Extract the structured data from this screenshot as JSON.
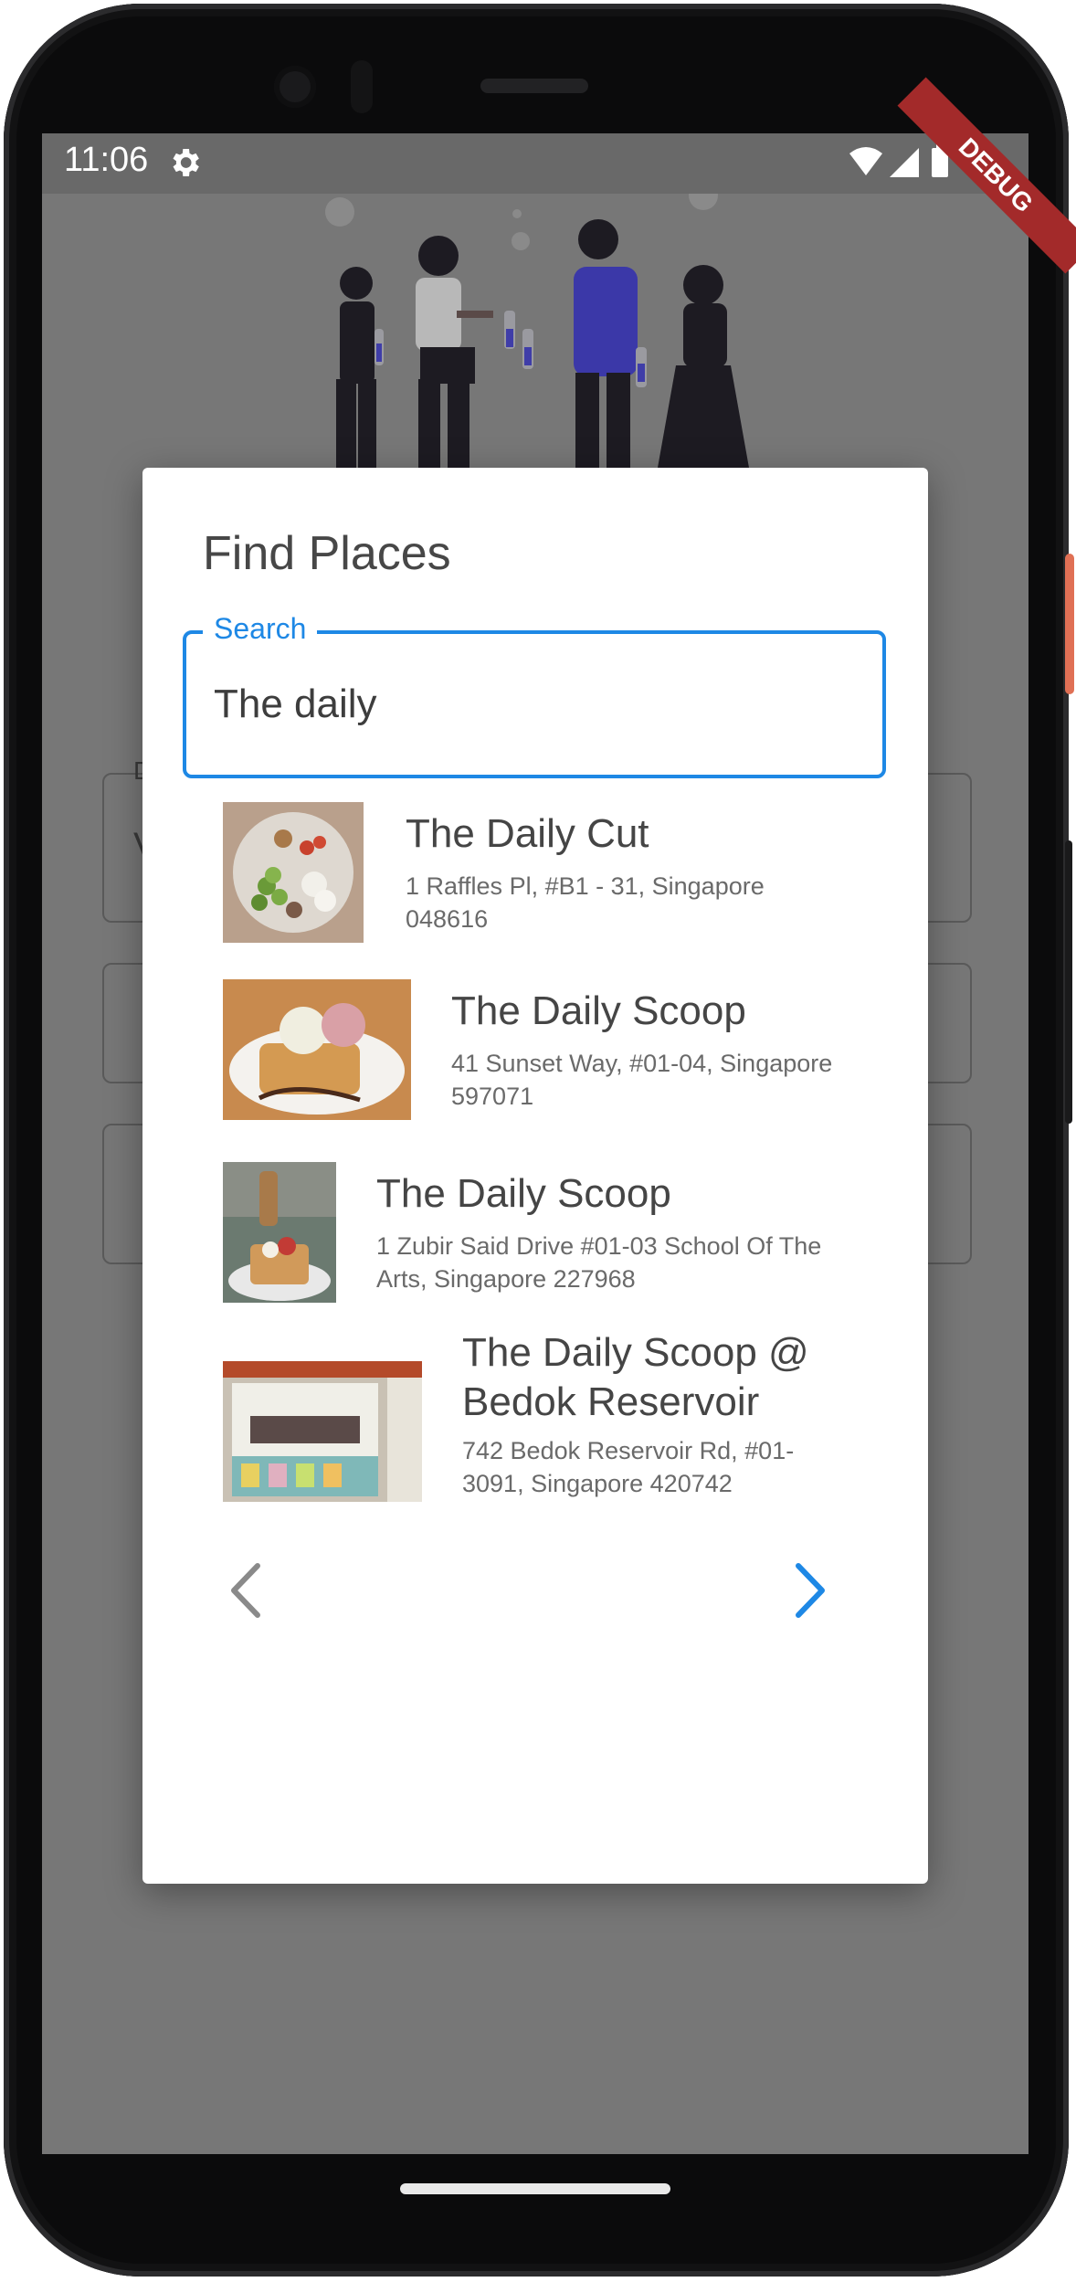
{
  "status_bar": {
    "time": "11:06",
    "icons": [
      "gear-icon",
      "wifi-icon",
      "signal-icon",
      "battery-icon"
    ],
    "debug_banner": "DEBUG"
  },
  "dialog": {
    "title": "Find Places",
    "search": {
      "label": "Search",
      "value": "The daily"
    },
    "results": [
      {
        "name": "The Daily Cut",
        "address": "1 Raffles Pl, #B1 - 31, Singapore 048616"
      },
      {
        "name": "The Daily Scoop",
        "address": "41 Sunset Way, #01-04, Singapore 597071"
      },
      {
        "name": "The Daily Scoop",
        "address": "1 Zubir Said Drive #01-03 School Of The Arts, Singapore 227968"
      },
      {
        "name": "The Daily Scoop @ Bedok Reservoir",
        "address": "742 Bedok Reservoir Rd, #01-3091, Singapore 420742"
      }
    ],
    "pagination": {
      "prev_icon": "chevron-left-icon",
      "next_icon": "chevron-right-icon"
    }
  },
  "background_form": {
    "field_label_fragment": "D",
    "field_value_fragment": "V"
  },
  "colors": {
    "accent": "#1e88e5",
    "scrim": "#777777",
    "debug": "#a32a2a"
  }
}
